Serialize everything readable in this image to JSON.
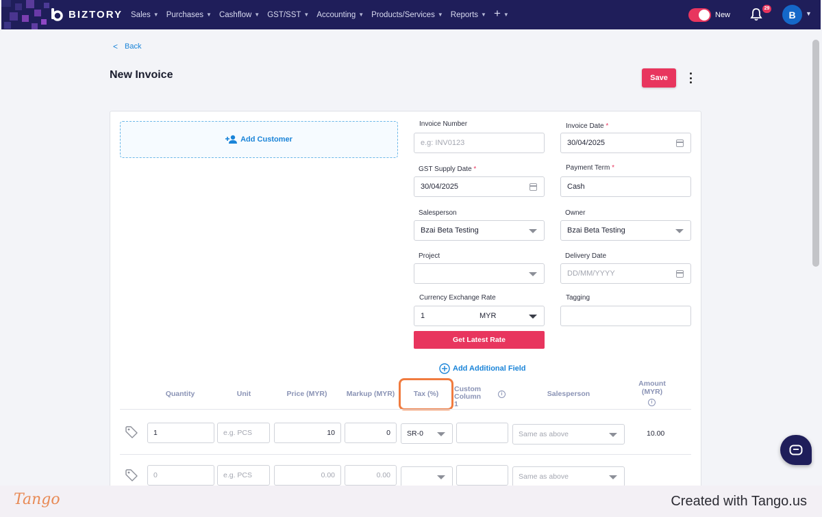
{
  "app": {
    "brand": "BIZTORY",
    "nav": [
      "Sales",
      "Purchases",
      "Cashflow",
      "GST/SST",
      "Accounting",
      "Products/Services",
      "Reports"
    ],
    "toggle_label": "New",
    "notification_count": "29",
    "avatar_initial": "B"
  },
  "page": {
    "back_label": "Back",
    "title": "New Invoice",
    "save_label": "Save",
    "add_customer_label": "Add Customer",
    "add_field_label": "Add Additional Field",
    "get_rate_label": "Get Latest Rate"
  },
  "form": {
    "invoice_number": {
      "label": "Invoice Number",
      "placeholder": "e.g: INV0123"
    },
    "invoice_date": {
      "label": "Invoice Date",
      "value": "30/04/2025"
    },
    "gst_supply_date": {
      "label": "GST Supply Date",
      "value": "30/04/2025"
    },
    "payment_term": {
      "label": "Payment Term",
      "value": "Cash"
    },
    "salesperson": {
      "label": "Salesperson",
      "value": "Bzai Beta Testing"
    },
    "owner": {
      "label": "Owner",
      "value": "Bzai Beta Testing"
    },
    "project": {
      "label": "Project",
      "value": ""
    },
    "delivery_date": {
      "label": "Delivery Date",
      "placeholder": "DD/MM/YYYY"
    },
    "currency_rate": {
      "label": "Currency Exchange Rate",
      "value": "1",
      "currency": "MYR"
    },
    "tagging": {
      "label": "Tagging",
      "value": ""
    }
  },
  "table": {
    "headers": {
      "quantity": "Quantity",
      "unit": "Unit",
      "price": "Price (MYR)",
      "markup": "Markup (MYR)",
      "tax": "Tax (%)",
      "custom1_line1": "Custom",
      "custom1_line2": "Column 1",
      "salesperson": "Salesperson",
      "amount_line1": "Amount",
      "amount_line2": "(MYR)"
    },
    "rows": [
      {
        "quantity": "1",
        "unit_placeholder": "e.g. PCS",
        "price": "10",
        "markup": "0",
        "tax": "SR-0",
        "custom1": "",
        "salesperson": "Same as above",
        "amount": "10.00"
      },
      {
        "quantity": "0",
        "unit_placeholder": "e.g. PCS",
        "price": "0.00",
        "markup": "0.00",
        "tax": "",
        "custom1": "",
        "salesperson": "Same as above",
        "amount": ""
      }
    ]
  },
  "footer": {
    "logo": "Tango",
    "created_with": "Created with Tango.us"
  }
}
